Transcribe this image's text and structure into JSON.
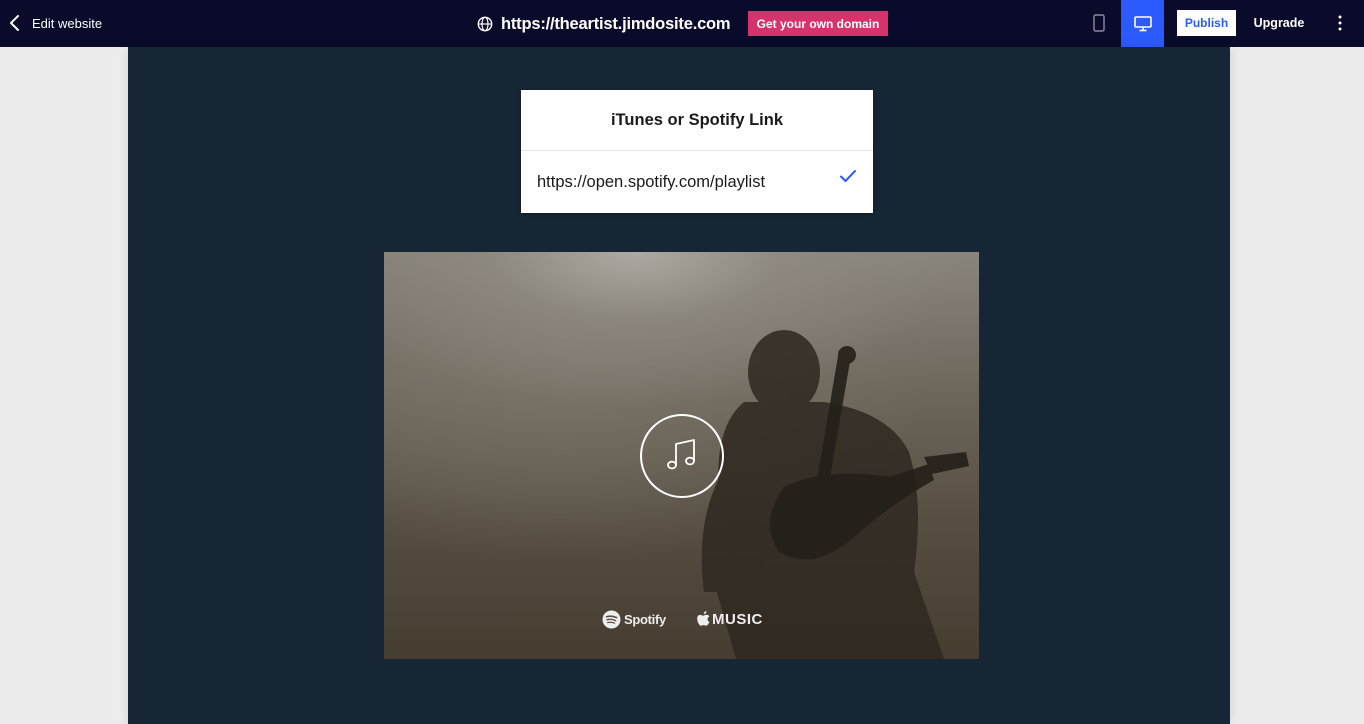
{
  "topbar": {
    "back_label": "Edit website",
    "url": "https://theartist.jimdosite.com",
    "domain_button": "Get your own domain",
    "publish_label": "Publish",
    "upgrade_label": "Upgrade",
    "colors": {
      "bar_bg": "#0a0a2a",
      "accent_pink": "#d6336c",
      "accent_blue": "#2b5bff"
    },
    "icons": [
      "chevron-left-icon",
      "globe-icon",
      "mobile-icon",
      "desktop-icon",
      "more-vertical-icon"
    ]
  },
  "popover": {
    "title": "iTunes or Spotify Link",
    "input_value": "https://open.spotify.com/playlist",
    "confirm_icon": "checkmark-icon"
  },
  "music_widget": {
    "icon": "music-note-icon",
    "logos": {
      "spotify": "Spotify",
      "apple": "MUSIC"
    }
  },
  "canvas": {
    "background": "#172634"
  }
}
